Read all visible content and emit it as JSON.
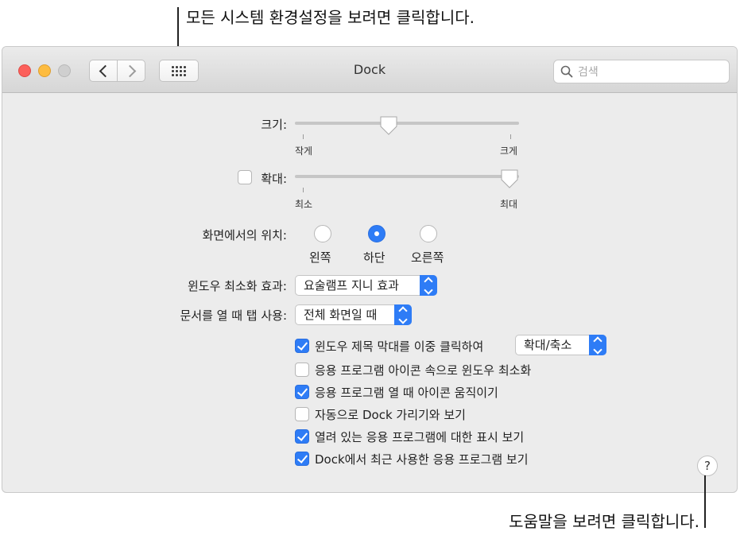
{
  "callouts": {
    "top": "모든 시스템 환경설정을 보려면 클릭합니다.",
    "bottom": "도움말을 보려면 클릭합니다."
  },
  "window": {
    "title": "Dock",
    "search_placeholder": "검색"
  },
  "size": {
    "label": "크기:",
    "min_label": "작게",
    "max_label": "크게",
    "value_fraction": 0.41
  },
  "magnification": {
    "label": "확대:",
    "checked": false,
    "min_label": "최소",
    "max_label": "최대",
    "value_fraction": 1.0
  },
  "position": {
    "label": "화면에서의 위치:",
    "options": [
      "왼쪽",
      "하단",
      "오른쪽"
    ],
    "selected": "하단"
  },
  "minimize_effect": {
    "label": "윈도우 최소화 효과:",
    "value": "요술램프 지니 효과"
  },
  "prefer_tabs": {
    "label": "문서를 열 때 탭 사용:",
    "value": "전체 화면일 때"
  },
  "options": [
    {
      "label": "윈도우 제목 막대를 이중 클릭하여",
      "checked": true
    },
    {
      "label": "응용 프로그램 아이콘 속으로 윈도우 최소화",
      "checked": false
    },
    {
      "label": "응용 프로그램 열 때 아이콘 움직이기",
      "checked": true
    },
    {
      "label": "자동으로 Dock 가리기와 보기",
      "checked": false
    },
    {
      "label": "열려 있는 응용 프로그램에 대한 표시 보기",
      "checked": true
    },
    {
      "label": "Dock에서 최근 사용한 응용 프로그램 보기",
      "checked": true
    }
  ],
  "double_click_action": {
    "value": "확대/축소"
  },
  "help": "?",
  "colors": {
    "accent": "#2e7cf6",
    "close": "#fc605b",
    "minimize": "#fdbc40"
  }
}
